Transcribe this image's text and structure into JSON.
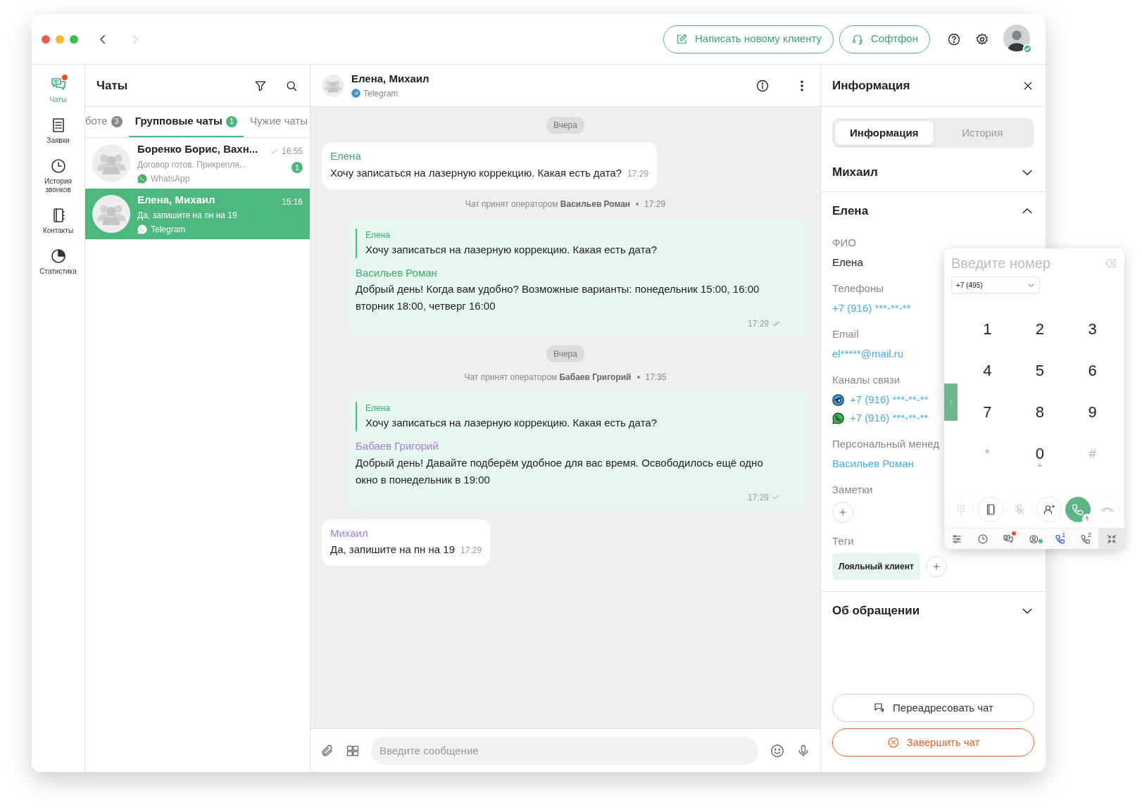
{
  "nav": {
    "back_disabled": false,
    "forward_disabled": true
  },
  "topbar": {
    "buttons": [
      {
        "kind": "compose",
        "label": "Написать новому клиенту"
      },
      {
        "kind": "softphone",
        "label": "Софтфон"
      }
    ],
    "user": {
      "online": true
    }
  },
  "rail": {
    "items": [
      {
        "kind": "chats",
        "label": "Чаты",
        "selected": true,
        "alert": true
      },
      {
        "kind": "requests",
        "label": "Заявки",
        "selected": false,
        "alert": false
      },
      {
        "kind": "calls",
        "label": "История звонков",
        "selected": false,
        "alert": false
      },
      {
        "kind": "contacts",
        "label": "Контакты",
        "selected": false,
        "alert": false
      },
      {
        "kind": "stats",
        "label": "Статистика",
        "selected": false,
        "alert": false
      }
    ]
  },
  "chat_list": {
    "title": "Чаты",
    "tabs": [
      {
        "label": "боте",
        "count": "3",
        "selected": false
      },
      {
        "label": "Групповые чаты",
        "count": "1",
        "selected": true
      },
      {
        "label": "Чужие чаты",
        "selected": false
      }
    ],
    "items": [
      {
        "name": "Боренко Борис, Вахн...",
        "preview": "Договор готов. Прикрепля...",
        "channel": "WhatsApp",
        "time": "16:55",
        "read": true,
        "unread": "1",
        "selected": false
      },
      {
        "name": "Елена, Михаил",
        "preview": "Да, запишите на пн на 19",
        "channel": "Telegram",
        "time": "15:16",
        "read": false,
        "selected": true
      }
    ]
  },
  "conversation": {
    "title": "Елена, Михаил",
    "channel": "Telegram",
    "messages": [
      {
        "kind": "date",
        "text": "Вчера"
      },
      {
        "kind": "incoming",
        "author": "Елена",
        "color": "#3daa6e",
        "text": "Хочу записаться на лазерную коррекцию. Какая есть дата?",
        "time": "17:29"
      },
      {
        "kind": "system",
        "text": "Чат принят оператором **Васильев Роман**",
        "time": "17:29"
      },
      {
        "kind": "outgoing",
        "quote_author": "Елена",
        "quote_text": "Хочу записаться на лазерную коррекцию. Какая есть дата?",
        "author": "Васильев Роман",
        "color": "#3daa6e",
        "text": "Добрый день! Когда вам удобно? Возможные варианты: понедельник 15:00, 16:00 вторник 18:00, четверг 16:00",
        "time": "17:29",
        "read": true
      },
      {
        "kind": "date",
        "text": "Вчера"
      },
      {
        "kind": "system",
        "text": "Чат принят оператором **Бабаев Григорий**",
        "time": "17:35"
      },
      {
        "kind": "outgoing",
        "quote_author": "Елена",
        "quote_text": "Хочу записаться на лазерную коррекцию. Какая есть дата?",
        "author": "Бабаев Григорий",
        "color": "#a47fe0",
        "text": "Добрый день! Давайте подберём удобное для вас время. Освободилось ещё одно окно в понедельник в 19:00",
        "time": "17:29",
        "read": false
      },
      {
        "kind": "incoming",
        "author": "Михаил",
        "color": "#a47fe0",
        "text": "Да, запишите на пн на 19",
        "time": "17:29"
      }
    ],
    "composer": {
      "placeholder": "Введите сообщение"
    }
  },
  "info": {
    "title": "Информация",
    "tabs": [
      {
        "label": "Информация",
        "selected": true
      },
      {
        "label": "История",
        "selected": false
      }
    ],
    "sections": [
      {
        "title": "Михаил",
        "expanded": false
      },
      {
        "title": "Елена",
        "expanded": true,
        "fields": [
          {
            "kind": "text",
            "label": "ФИО",
            "value": "Елена"
          },
          {
            "kind": "link",
            "label": "Телефоны",
            "value": "+7 (916) ***-**-**"
          },
          {
            "kind": "link",
            "label": "Email",
            "value": "el*****@mail.ru"
          },
          {
            "kind": "channels",
            "label": "Каналы связи",
            "items": [
              {
                "kind": "telegram",
                "value": "+7 (916) ***-**-**"
              },
              {
                "kind": "whatsapp",
                "value": "+7 (916) ***-**-**"
              }
            ]
          },
          {
            "kind": "link",
            "label": "Персональный менед",
            "value": "Васильев Роман"
          },
          {
            "kind": "add",
            "label": "Заметки"
          },
          {
            "kind": "tags",
            "label": "Теги",
            "tags": [
              "Лояльный клиент"
            ]
          }
        ]
      },
      {
        "title": "Об обращении",
        "expanded": false
      }
    ],
    "buttons": [
      {
        "kind": "forward",
        "label": "Переадресовать чат"
      },
      {
        "kind": "end",
        "label": "Завершить чат"
      }
    ]
  },
  "dialer": {
    "placeholder": "Введите номер",
    "prefix": "+7 (495)",
    "keys": [
      {
        "digit": "1",
        "dim": false
      },
      {
        "digit": "2",
        "dim": false
      },
      {
        "digit": "3",
        "dim": false
      },
      {
        "digit": "4",
        "dim": false
      },
      {
        "digit": "5",
        "dim": false
      },
      {
        "digit": "6",
        "dim": false
      },
      {
        "digit": "7",
        "dim": false
      },
      {
        "digit": "8",
        "dim": false
      },
      {
        "digit": "9",
        "dim": false
      },
      {
        "digit": "*",
        "dim": true
      },
      {
        "digit": "0",
        "sub": "+",
        "dim": false
      },
      {
        "digit": "#",
        "dim": true
      }
    ],
    "actions": [
      {
        "kind": "keypad",
        "disabled": true
      },
      {
        "kind": "contacts",
        "disabled": false
      },
      {
        "kind": "mute",
        "disabled": true
      },
      {
        "kind": "transfer",
        "disabled": false
      },
      {
        "kind": "call",
        "disabled": false
      },
      {
        "kind": "hangup",
        "disabled": true
      }
    ],
    "toolbar": [
      {
        "kind": "settings",
        "active": false
      },
      {
        "kind": "history",
        "active": false
      },
      {
        "kind": "chats",
        "active": false,
        "alert": true
      },
      {
        "kind": "status",
        "active": false
      },
      {
        "kind": "line",
        "label": "1",
        "active": true
      },
      {
        "kind": "line",
        "label": "2",
        "active": false
      },
      {
        "kind": "collapse",
        "active": true
      }
    ]
  }
}
